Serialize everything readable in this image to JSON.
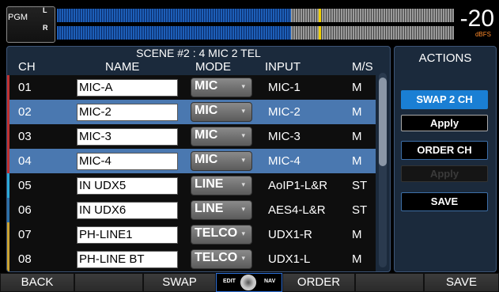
{
  "meter": {
    "label": "PGM",
    "left_channel": "L",
    "right_channel": "R",
    "level_value": "-20",
    "level_unit": "dBFS",
    "left_level_fraction": 0.59,
    "right_level_fraction": 0.59,
    "peak_fraction": 0.66,
    "colors": {
      "level": "#1d5fb8",
      "inactive": "#9a9a9a",
      "peak": "#f0d000",
      "unit": "#ff8a2a"
    }
  },
  "table": {
    "scene_title": "SCENE #2 : 4 MIC 2 TEL",
    "headers": {
      "ch": "CH",
      "name": "NAME",
      "mode": "MODE",
      "input": "INPUT",
      "ms": "M/S"
    },
    "rows": [
      {
        "ch": "01",
        "name": "MIC-A",
        "mode": "MIC",
        "input": "MIC-1",
        "ms": "M",
        "selected": false,
        "accent": "#c03030"
      },
      {
        "ch": "02",
        "name": "MIC-2",
        "mode": "MIC",
        "input": "MIC-2",
        "ms": "M",
        "selected": true,
        "accent": "#c03030"
      },
      {
        "ch": "03",
        "name": "MIC-3",
        "mode": "MIC",
        "input": "MIC-3",
        "ms": "M",
        "selected": false,
        "accent": "#c03030"
      },
      {
        "ch": "04",
        "name": "MIC-4",
        "mode": "MIC",
        "input": "MIC-4",
        "ms": "M",
        "selected": true,
        "accent": "#c03030"
      },
      {
        "ch": "05",
        "name": "IN UDX5",
        "mode": "LINE",
        "input": "AoIP1-L&R",
        "ms": "ST",
        "selected": false,
        "accent": "#2aa8d8"
      },
      {
        "ch": "06",
        "name": "IN UDX6",
        "mode": "LINE",
        "input": "AES4-L&R",
        "ms": "ST",
        "selected": false,
        "accent": "#2a6fa8"
      },
      {
        "ch": "07",
        "name": "PH-LINE1",
        "mode": "TELCO",
        "input": "UDX1-R",
        "ms": "M",
        "selected": false,
        "accent": "#c8a030"
      },
      {
        "ch": "08",
        "name": "PH-LINE BT",
        "mode": "TELCO",
        "input": "UDX1-L",
        "ms": "M",
        "selected": false,
        "accent": "#c8a030"
      }
    ],
    "dropdown_icon": "chevron-down-icon"
  },
  "actions": {
    "title": "ACTIONS",
    "swap_label": "SWAP 2 CH",
    "apply_swap_label": "Apply",
    "order_label": "ORDER CH",
    "apply_order_label": "Apply",
    "save_label": "SAVE"
  },
  "footer": {
    "back": "BACK",
    "swap": "SWAP",
    "knob_edit": "EDIT",
    "knob_nav": "NAV",
    "order": "ORDER",
    "save": "SAVE"
  }
}
